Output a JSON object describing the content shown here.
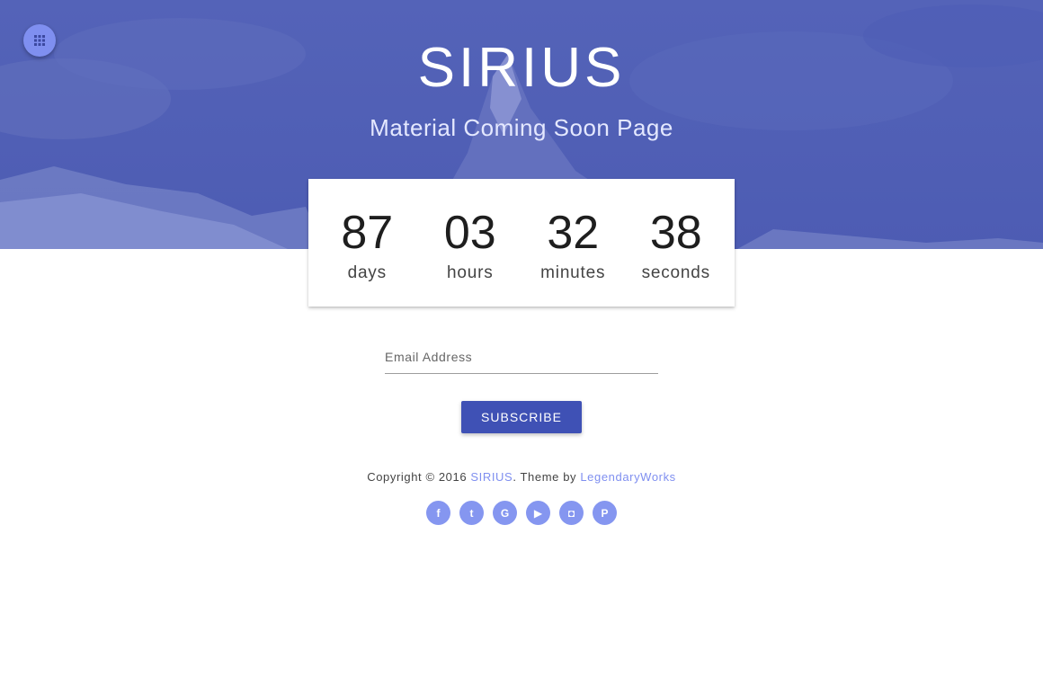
{
  "hero": {
    "title": "SIRIUS",
    "subtitle": "Material Coming Soon Page",
    "overlay_color": "#4a59b4"
  },
  "menu": {
    "icon": "grid-icon"
  },
  "countdown": [
    {
      "value": "87",
      "label": "days"
    },
    {
      "value": "03",
      "label": "hours"
    },
    {
      "value": "32",
      "label": "minutes"
    },
    {
      "value": "38",
      "label": "seconds"
    }
  ],
  "subscribe": {
    "email_placeholder": "Email Address",
    "button_label": "SUBSCRIBE",
    "button_color": "#3f51b5"
  },
  "footer": {
    "copyright_prefix": "Copyright © 2016 ",
    "brand_link": "SIRIUS",
    "theme_by": ". Theme by ",
    "author_link": "LegendaryWorks",
    "link_color": "#7f8ff0"
  },
  "social": [
    {
      "name": "facebook-icon",
      "glyph": "f"
    },
    {
      "name": "twitter-icon",
      "glyph": "t"
    },
    {
      "name": "google-icon",
      "glyph": "G"
    },
    {
      "name": "youtube-icon",
      "glyph": "▶"
    },
    {
      "name": "instagram-icon",
      "glyph": "◘"
    },
    {
      "name": "pinterest-icon",
      "glyph": "P"
    }
  ]
}
